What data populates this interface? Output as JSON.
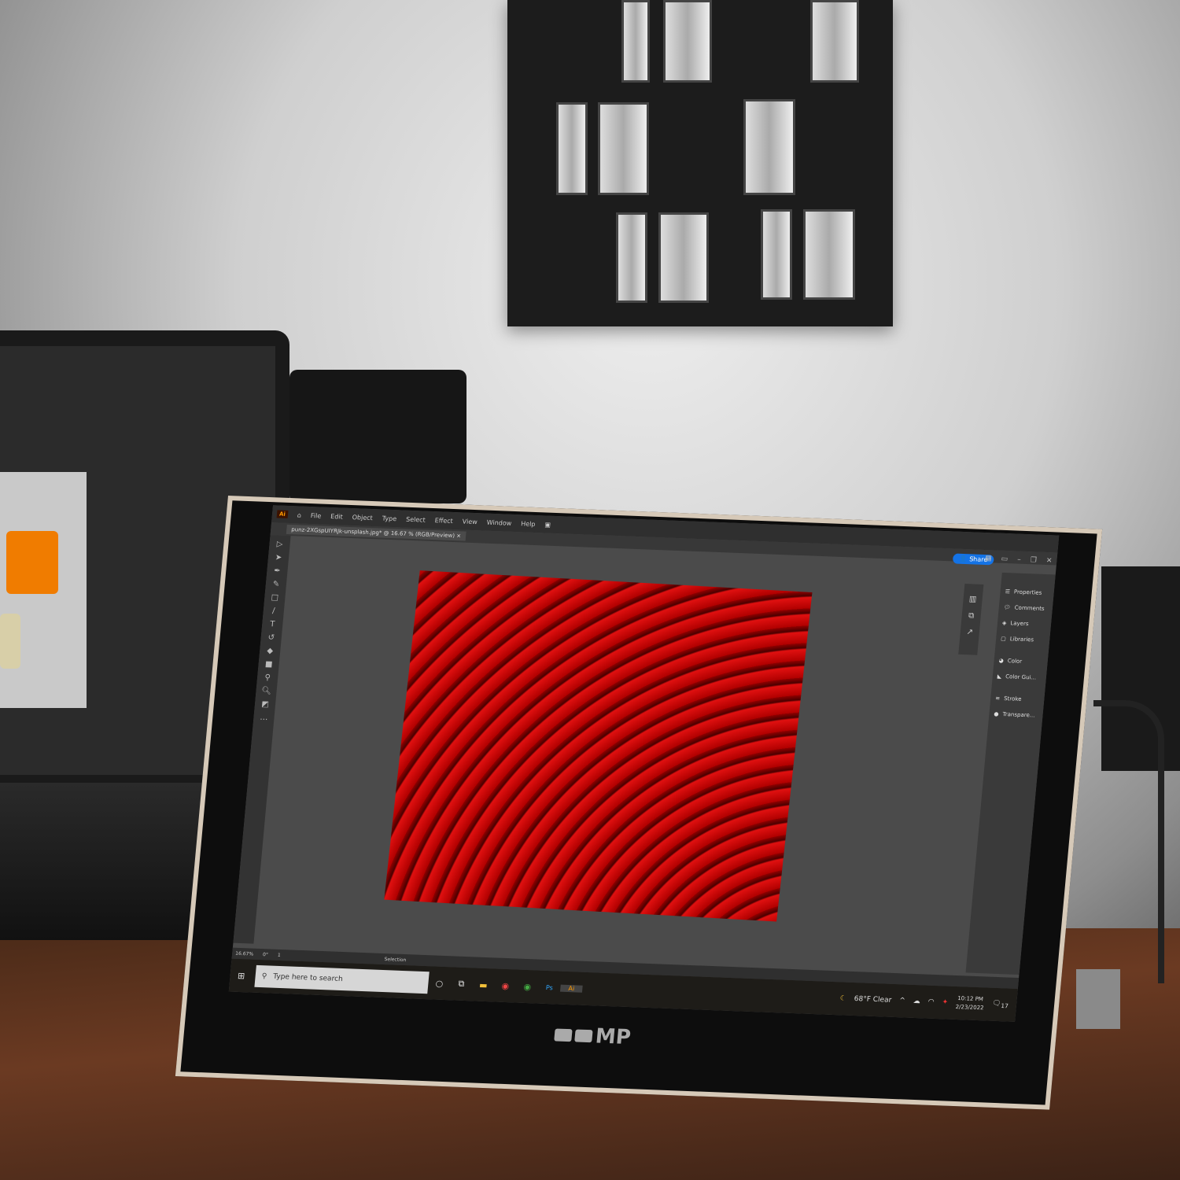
{
  "app": {
    "logo": "Ai",
    "menu": [
      "File",
      "Edit",
      "Object",
      "Type",
      "Select",
      "Effect",
      "View",
      "Window",
      "Help"
    ],
    "document_tab": "punz-2XGspUIYRJk-unsplash.jpg* @ 16.67 % (RGB/Preview)",
    "share_label": "Share",
    "panels": [
      {
        "icon": "properties-icon",
        "label": "Properties"
      },
      {
        "icon": "comments-icon",
        "label": "Comments"
      },
      {
        "icon": "layers-icon",
        "label": "Layers"
      },
      {
        "icon": "libraries-icon",
        "label": "Libraries"
      },
      {
        "icon": "color-icon",
        "label": "Color"
      },
      {
        "icon": "color-guide-icon",
        "label": "Color Gui..."
      },
      {
        "icon": "stroke-icon",
        "label": "Stroke"
      },
      {
        "icon": "transparency-icon",
        "label": "Transpare..."
      }
    ],
    "status": {
      "zoom": "16.67%",
      "rotation": "0°",
      "artboard": "1",
      "tool": "Selection"
    }
  },
  "taskbar": {
    "search_placeholder": "Type here to search",
    "weather": "68°F Clear",
    "time": "10:12 PM",
    "date": "2/23/2022",
    "notifications": "17",
    "apps": [
      "Cortana",
      "Task View",
      "File Explorer",
      "Chrome",
      "Chrome",
      "Ps",
      "Ai"
    ]
  },
  "brand": "MP",
  "colors": {
    "accent": "#1473e6",
    "artwork": "#c00000"
  }
}
